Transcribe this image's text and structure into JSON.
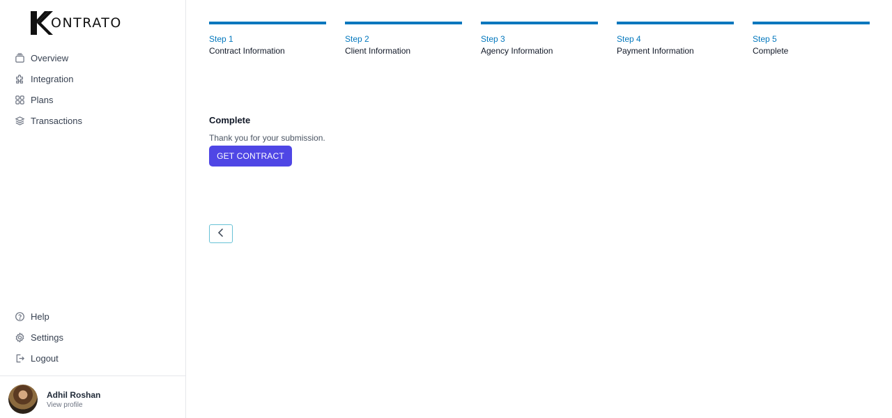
{
  "brand": {
    "logo_letter": "K",
    "logo_rest": "ONTRATO"
  },
  "sidebar": {
    "items": [
      {
        "label": "Overview",
        "icon": "overview-icon"
      },
      {
        "label": "Integration",
        "icon": "puzzle-icon"
      },
      {
        "label": "Plans",
        "icon": "grid-icon"
      },
      {
        "label": "Transactions",
        "icon": "layers-icon"
      }
    ],
    "bottom_items": [
      {
        "label": "Help",
        "icon": "help-icon"
      },
      {
        "label": "Settings",
        "icon": "gear-icon"
      },
      {
        "label": "Logout",
        "icon": "logout-icon"
      }
    ],
    "profile": {
      "name": "Adhil Roshan",
      "link": "View profile"
    }
  },
  "steps": [
    {
      "num": "Step 1",
      "title": "Contract Information"
    },
    {
      "num": "Step 2",
      "title": "Client Information"
    },
    {
      "num": "Step 3",
      "title": "Agency Information"
    },
    {
      "num": "Step 4",
      "title": "Payment Information"
    },
    {
      "num": "Step 5",
      "title": "Complete"
    }
  ],
  "content": {
    "title": "Complete",
    "message": "Thank you for your submission.",
    "button_label": "GET CONTRACT"
  },
  "colors": {
    "accent": "#0277bd",
    "primary_button": "#4f46e5",
    "back_button_border": "#67c2d6"
  }
}
